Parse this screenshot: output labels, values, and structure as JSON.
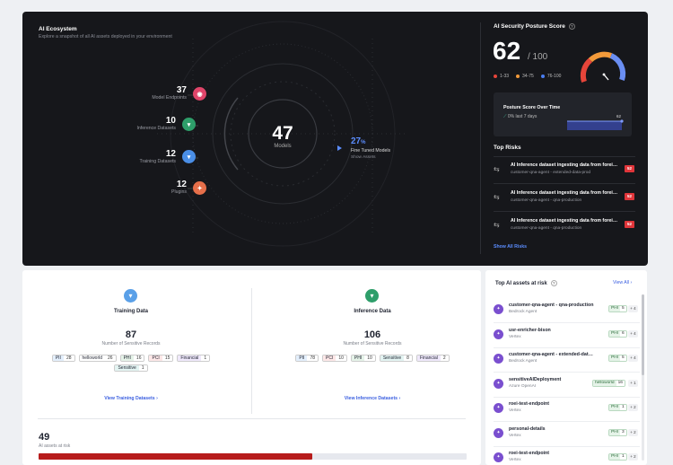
{
  "ecosystem": {
    "title": "AI Ecosystem",
    "subtitle": "Explore a snapshot of all AI assets deployed in your environment",
    "items": [
      {
        "count": "37",
        "label": "Model Endpoints",
        "color": "#e0456a"
      },
      {
        "count": "10",
        "label": "Inference Datasets",
        "color": "#2e9e6a"
      },
      {
        "count": "12",
        "label": "Training Datasets",
        "color": "#4a8ee6"
      },
      {
        "count": "12",
        "label": "Plugins",
        "color": "#e66f4a"
      }
    ],
    "center": {
      "count": "47",
      "label": "Models"
    },
    "fine_tuned": {
      "count": "27",
      "unit": "%",
      "label": "Fine Tuned Models",
      "link": "Show Assets"
    }
  },
  "posture": {
    "title": "AI Security Posture Score",
    "score": "62",
    "of": "/ 100",
    "score_fraction": 0.62,
    "legend": [
      {
        "label": "1-33",
        "color": "#e6453a"
      },
      {
        "label": "34-75",
        "color": "#f29a3a"
      },
      {
        "label": "76-100",
        "color": "#4a7ef2"
      }
    ],
    "over_time": {
      "title": "Posture Score Over Time",
      "change": "0% last 7 days",
      "value": "62"
    }
  },
  "top_risks": {
    "title": "Top Risks",
    "items": [
      {
        "title": "AI Inference dataset ingesting data from forei…",
        "subtitle": "customer-qna-agent - extended-data-prod",
        "badge": "52"
      },
      {
        "title": "AI Inference dataset ingesting data from forei…",
        "subtitle": "customer-qna-agent - qna-production",
        "badge": "52"
      },
      {
        "title": "AI Inference dataset ingesting data from forei…",
        "subtitle": "customer-qna-agent - qna-production",
        "badge": "52"
      }
    ],
    "link": "Show All Risks"
  },
  "training": {
    "title": "Training Data",
    "count": "87",
    "sub": "Number of Sensitive Records",
    "tags": [
      {
        "k": "PII",
        "v": "28",
        "bg": "#e3effc"
      },
      {
        "k": "helloworld",
        "v": "26",
        "bg": "#ffffff"
      },
      {
        "k": "PHI",
        "v": "16",
        "bg": "#e5f3e8"
      },
      {
        "k": "PCI",
        "v": "15",
        "bg": "#fde7e7"
      },
      {
        "k": "Financial",
        "v": "1",
        "bg": "#efe8fb"
      },
      {
        "k": "Sensitive",
        "v": "1",
        "bg": "#e3f4f2"
      }
    ],
    "link": "View Training Datasets"
  },
  "inference": {
    "title": "Inference Data",
    "count": "106",
    "sub": "Number of Sensitive Records",
    "tags": [
      {
        "k": "PII",
        "v": "78",
        "bg": "#e3effc"
      },
      {
        "k": "PCI",
        "v": "10",
        "bg": "#fde7e7"
      },
      {
        "k": "PHI",
        "v": "10",
        "bg": "#e5f3e8"
      },
      {
        "k": "Sensitive",
        "v": "8",
        "bg": "#e3f4f2"
      },
      {
        "k": "Financial",
        "v": "2",
        "bg": "#efe8fb"
      }
    ],
    "link": "View Inference Datasets"
  },
  "at_risk": {
    "count": "49",
    "label": "AI assets at risk",
    "fraction": 0.64
  },
  "top_assets": {
    "title": "Top AI assets at risk",
    "view_all": "View All",
    "items": [
      {
        "name": "customer-qna-agent - qna-production",
        "source": "Bedrock Agent",
        "tag": "PHI",
        "tag_count": "5",
        "more": "+ 4"
      },
      {
        "name": "usr-enricher-bison",
        "source": "Vertex",
        "tag": "PHI",
        "tag_count": "6",
        "more": "+ 4"
      },
      {
        "name": "customer-qna-agent - extended-dat…",
        "source": "Bedrock Agent",
        "tag": "PHI",
        "tag_count": "5",
        "more": "+ 4"
      },
      {
        "name": "sensitiveAIDeployment",
        "source": "Azure OpenAI",
        "tag": "helloworld",
        "tag_count": "16",
        "more": "+ 1"
      },
      {
        "name": "roei-test-endpoint",
        "source": "Vertex",
        "tag": "PHI",
        "tag_count": "1",
        "more": "+ 2"
      },
      {
        "name": "personal-details",
        "source": "Vertex",
        "tag": "PHI",
        "tag_count": "3",
        "more": "+ 2"
      },
      {
        "name": "roei-test-endpoint",
        "source": "Vertex",
        "tag": "PHI",
        "tag_count": "1",
        "more": "+ 2"
      }
    ]
  }
}
